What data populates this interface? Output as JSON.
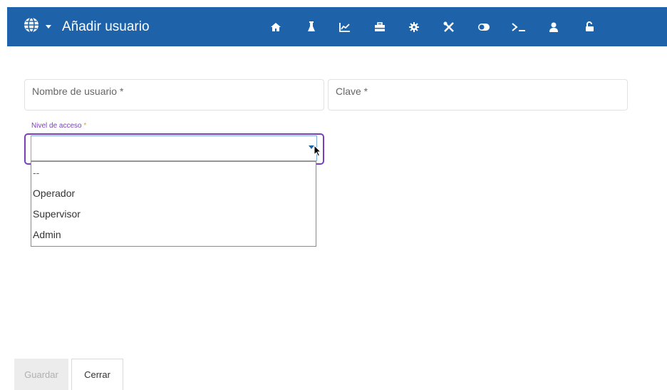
{
  "header": {
    "title": "Añadir usuario",
    "background": "#1e63aa",
    "icons": [
      "globe-icon",
      "caret-down-icon",
      "home-icon",
      "flask-icon",
      "chart-icon",
      "briefcase-icon",
      "gear-icon",
      "tools-icon",
      "toggle-icon",
      "terminal-icon",
      "user-icon",
      "unlock-icon"
    ]
  },
  "form": {
    "username_label": "Nombre de usuario *",
    "password_label": "Clave *",
    "access_label": "Nivel de acceso",
    "access_required": "*",
    "access_value": "",
    "options": [
      "--",
      "Operador",
      "Supervisor",
      "Admin"
    ],
    "accent": "#7a3fbd"
  },
  "buttons": {
    "save": "Guardar",
    "close": "Cerrar"
  }
}
